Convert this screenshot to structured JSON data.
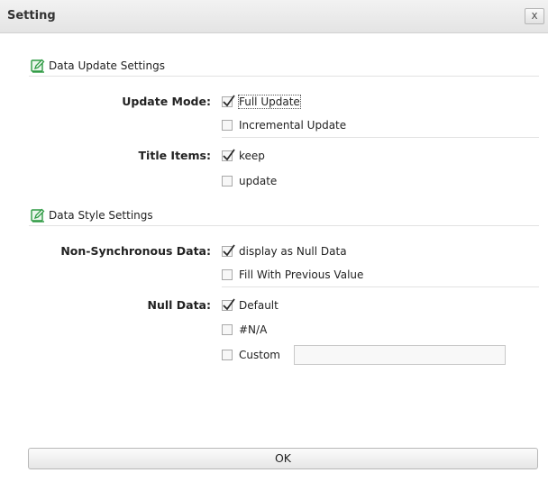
{
  "window": {
    "title": "Setting",
    "close_glyph": "x"
  },
  "update_section": {
    "title": "Data Update Settings",
    "icon": "edit-icon",
    "update_mode": {
      "label": "Update Mode:",
      "options": [
        {
          "label": "Full Update",
          "checked": true
        },
        {
          "label": "Incremental Update",
          "checked": false
        }
      ]
    },
    "title_items": {
      "label": "Title Items:",
      "options": [
        {
          "label": "keep",
          "checked": true
        },
        {
          "label": "update",
          "checked": false
        }
      ]
    }
  },
  "style_section": {
    "title": "Data Style Settings",
    "icon": "edit-icon",
    "non_sync": {
      "label": "Non-Synchronous Data:",
      "options": [
        {
          "label": "display as Null Data",
          "checked": true
        },
        {
          "label": "Fill With Previous Value",
          "checked": false
        }
      ]
    },
    "null_data": {
      "label": "Null Data:",
      "options": [
        {
          "label": "Default",
          "checked": true
        },
        {
          "label": "#N/A",
          "checked": false
        },
        {
          "label": "Custom",
          "checked": false
        }
      ],
      "custom_value": ""
    }
  },
  "ok_label": "OK",
  "colors": {
    "accent_green": "#2e9a43",
    "tick": "#2b2b2b"
  }
}
